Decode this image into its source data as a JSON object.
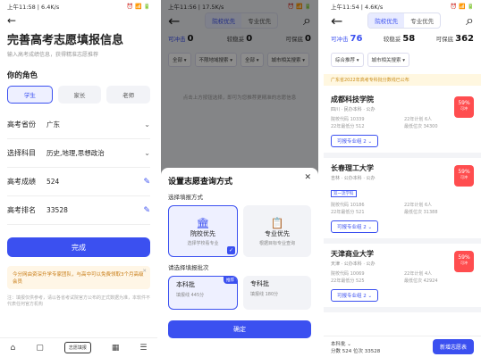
{
  "p1": {
    "status_time": "上午11:58 | 6.4K/s",
    "status_icons": "⏰ 📶 🔋",
    "back": "←",
    "title": "完善高考志愿填报信息",
    "subtitle": "输入高考成绩信息，获得精准志愿推荐",
    "role_title": "你的角色",
    "roles": [
      "学生",
      "家长",
      "老师"
    ],
    "fields": [
      {
        "label": "高考省份",
        "value": "广东",
        "end": "⌄"
      },
      {
        "label": "选择科目",
        "value": "历史,地理,思想政治",
        "end": "⌄"
      },
      {
        "label": "高考成绩",
        "value": "524",
        "end": "✎"
      },
      {
        "label": "高考排名",
        "value": "33528",
        "end": "✎"
      }
    ],
    "done": "完成",
    "tip": "今分网由资深升学专家团队，与高中可以免费领取3个月高级会员",
    "notice": "注：填报仅供参考，请以各省考试院官方公布的正式数据为准，本软件不代表任何官方机构",
    "nav": [
      "⌂",
      "▢",
      "志愿填报",
      "▦",
      "☰"
    ]
  },
  "p2": {
    "status_time": "上午11:56 | 17.5K/s",
    "seg": [
      "院校优先",
      "专业优先"
    ],
    "stats": {
      "c1": "可冲击",
      "v1": "0",
      "c2": "较稳妥",
      "v2": "0",
      "c3": "可保底",
      "v3": "0"
    },
    "filters": [
      "全部 ▾",
      "不限地域搜索 ▾",
      "全部 ▾",
      "城市相关搜索 ▾"
    ],
    "empty": "点击上方按钮选择，即可为您推荐更精准的志愿信息",
    "sheet_title": "设置志愿查询方式",
    "mode_label": "选择填报方式",
    "mode_cards": [
      {
        "icon": "🏛",
        "name": "院校优先",
        "sub": "选择学校看专业"
      },
      {
        "icon": "📋",
        "name": "专业优先",
        "sub": "根据目标专业查询"
      }
    ],
    "batch_label": "请选择填报批次",
    "batches": [
      {
        "name": "本科批",
        "sub": "填报线 445分",
        "tag": "推荐"
      },
      {
        "name": "专科批",
        "sub": "填报线 180分"
      }
    ],
    "confirm": "确定"
  },
  "p3": {
    "status_time": "上午11:54 | 4.6K/s",
    "seg": [
      "院校优先",
      "专业优先"
    ],
    "stats": {
      "c1": "可冲击",
      "v1": "76",
      "c2": "较稳妥",
      "v2": "58",
      "c3": "可保底",
      "v3": "362"
    },
    "filters": [
      "综合推荐 ▾",
      "城市相关搜索 ▾"
    ],
    "banner": "广东省2022年高考专科批分数线已公布",
    "unis": [
      {
        "name": "成都科技学院",
        "tags": "四川 · 民办本科 · 公办",
        "grid": [
          "院校代码 10339",
          "22年计划 6人",
          "22年最低分 512",
          "最低位次 34300"
        ],
        "pct": "59%",
        "pct_sub": "可冲",
        "btn": "可报专业组 2 ⌄",
        "label": ""
      },
      {
        "name": "长春理工大学",
        "tags": "吉林 · 公办本科 · 公办",
        "grid": [
          "院校代码 10186",
          "22年计划 6人",
          "22年最低分 521",
          "最低位次 31388"
        ],
        "pct": "59%",
        "pct_sub": "可冲",
        "btn": "可报专业组 2 ⌄",
        "label": "双一流学科"
      },
      {
        "name": "天津商业大学",
        "tags": "天津 · 公办本科 · 公办",
        "grid": [
          "院校代码 10069",
          "22年计划 4人",
          "22年最低分 525",
          "最低位次 42924"
        ],
        "pct": "59%",
        "pct_sub": "可冲",
        "btn": "可报专业组 2 ⌄",
        "label": ""
      }
    ],
    "bottom_info1": "本科批 ⌄",
    "bottom_info2": "分数 524  位次 33528",
    "bottom_btn": "新增志愿表"
  }
}
